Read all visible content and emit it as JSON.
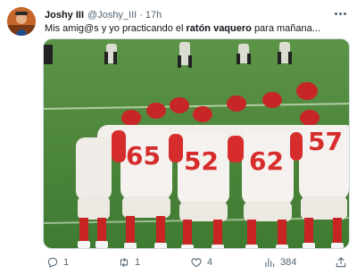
{
  "tweet": {
    "display_name": "Joshy III",
    "handle": "@Joshy_III",
    "separator": "·",
    "time": "17h",
    "text_before": "Mis amig@s y yo practicando el",
    "text_bold": "ratón vaquero",
    "text_after": "para mañana...",
    "media_alt_numbers": [
      "65",
      "52",
      "62",
      "57"
    ],
    "stats": {
      "replies": "1",
      "retweets": "1",
      "likes": "4",
      "views": "384"
    }
  },
  "icons": {
    "more": "more-horizontal-icon",
    "reply": "reply-icon",
    "retweet": "retweet-icon",
    "like": "heart-icon",
    "views": "views-bar-chart-icon",
    "share": "share-icon"
  },
  "colors": {
    "text": "#0f1419",
    "secondary": "#536471",
    "field_green": "#4f8a3d",
    "jersey_red": "#d62c2c",
    "jersey_white": "#f4f1ee"
  }
}
